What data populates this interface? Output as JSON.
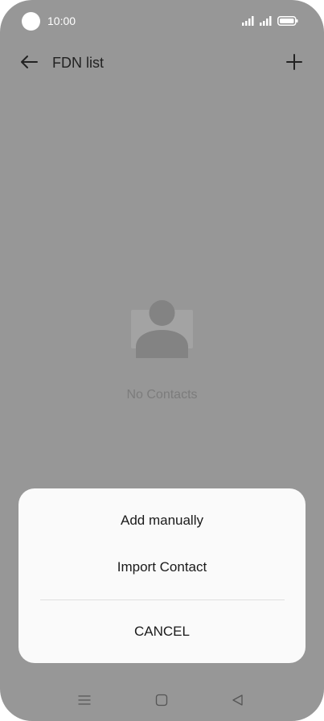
{
  "status_bar": {
    "time": "10:00",
    "icons": [
      "signal-icon",
      "signal-icon",
      "battery-icon"
    ]
  },
  "app_bar": {
    "title": "FDN list",
    "back_icon": "arrow-left-icon",
    "add_icon": "plus-icon"
  },
  "empty_state": {
    "icon": "contact-placeholder-icon",
    "text": "No Contacts"
  },
  "bottom_sheet": {
    "items": [
      {
        "label": "Add manually"
      },
      {
        "label": "Import Contact"
      }
    ],
    "cancel_label": "CANCEL"
  },
  "nav_bar": {
    "icons": [
      "menu-icon",
      "home-icon",
      "back-triangle-icon"
    ]
  },
  "colors": {
    "scrim": "#979797",
    "sheet": "#fafafa",
    "text_dark": "#1a1a1a",
    "text_muted": "#7c7c7c"
  }
}
